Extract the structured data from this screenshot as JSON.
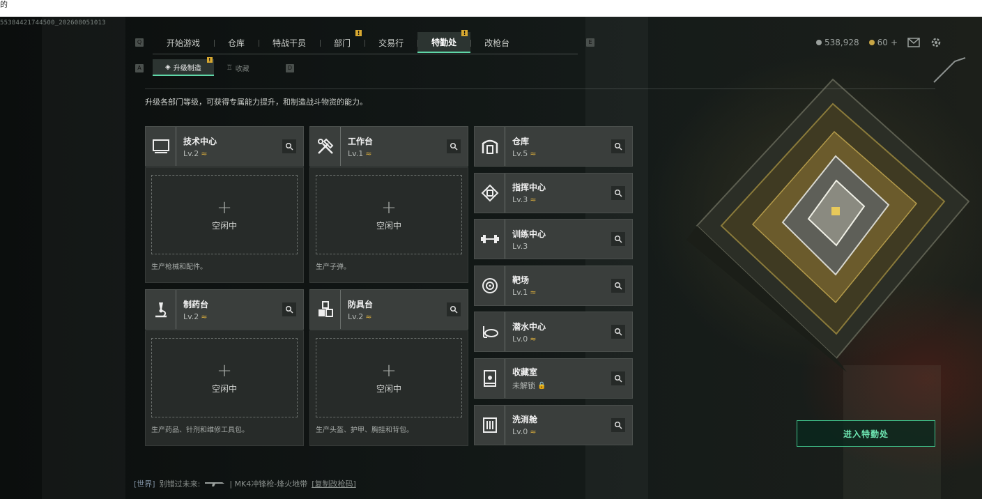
{
  "window": {
    "title_fragment": "的"
  },
  "session_id": "55384421744500_202608051013",
  "hotkeys": {
    "tabs_left": "Q",
    "tabs_right": "E",
    "sub_left": "A",
    "sub_right": "D"
  },
  "nav": {
    "tabs": [
      {
        "label": "开始游戏",
        "warn": ""
      },
      {
        "label": "仓库",
        "warn": ""
      },
      {
        "label": "特战干员",
        "warn": ""
      },
      {
        "label": "部门",
        "warn": "!"
      },
      {
        "label": "交易行",
        "warn": ""
      },
      {
        "label": "特勤处",
        "warn": "!"
      },
      {
        "label": "改枪台",
        "warn": ""
      }
    ],
    "active": "特勤处"
  },
  "subtabs": [
    {
      "label": "升级制造",
      "warn": "!"
    },
    {
      "label": "收藏",
      "warn": ""
    }
  ],
  "status": {
    "currency": "538,928",
    "tickets": "60",
    "add": "+"
  },
  "description": "升级各部门等级，可获得专属能力提升，和制造战斗物资的能力。",
  "workstations": [
    {
      "name": "技术中心",
      "level": "Lv.2",
      "upgrade": true,
      "icon": "monitor-icon",
      "idle": "空闲中",
      "caption": "生产枪械和配件。"
    },
    {
      "name": "工作台",
      "level": "Lv.1",
      "upgrade": true,
      "icon": "tools-icon",
      "idle": "空闲中",
      "caption": "生产子弹。"
    },
    {
      "name": "制药台",
      "level": "Lv.2",
      "upgrade": true,
      "icon": "microscope-icon",
      "idle": "空闲中",
      "caption": "生产药品、针剂和维修工具包。"
    },
    {
      "name": "防具台",
      "level": "Lv.2",
      "upgrade": true,
      "icon": "armor-icon",
      "idle": "空闲中",
      "caption": "生产头盔、护甲、胸挂和背包。"
    }
  ],
  "facilities": [
    {
      "name": "仓库",
      "level": "Lv.5",
      "upgrade": true,
      "icon": "warehouse-icon"
    },
    {
      "name": "指挥中心",
      "level": "Lv.3",
      "upgrade": true,
      "icon": "chip-icon"
    },
    {
      "name": "训练中心",
      "level": "Lv.3",
      "upgrade": false,
      "icon": "dumbbell-icon"
    },
    {
      "name": "靶场",
      "level": "Lv.1",
      "upgrade": true,
      "icon": "target-icon"
    },
    {
      "name": "潜水中心",
      "level": "Lv.0",
      "upgrade": true,
      "icon": "diving-mask-icon"
    },
    {
      "name": "收藏室",
      "level": "未解锁",
      "upgrade": false,
      "locked": true,
      "icon": "display-case-icon"
    },
    {
      "name": "洗消舱",
      "level": "Lv.0",
      "upgrade": true,
      "icon": "decontamination-icon"
    }
  ],
  "enter_button": "进入特勤处",
  "chat": {
    "channel": "[世界]",
    "user": "别错过未来:",
    "message": "| MK4冲锋枪-烽火地带",
    "link": "[复制改枪码]"
  },
  "colors": {
    "accent": "#5fd7a8",
    "warning": "#d8a931",
    "upgrade": "#e0b23c",
    "panel": "#3a3e3c"
  }
}
